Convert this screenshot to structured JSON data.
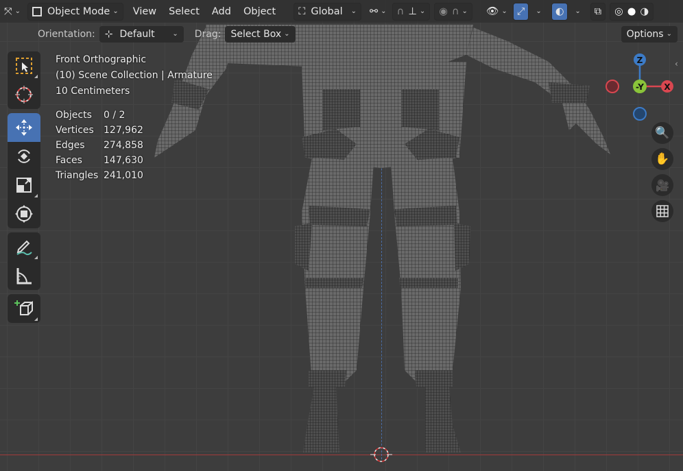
{
  "header": {
    "mode": "Object Mode",
    "menus": [
      "View",
      "Select",
      "Add",
      "Object"
    ],
    "transform_orientation": "Global"
  },
  "tool_settings": {
    "orientation_label": "Orientation:",
    "orientation_value": "Default",
    "drag_label": "Drag:",
    "drag_value": "Select Box",
    "options_label": "Options"
  },
  "viewport": {
    "view_name": "Front Orthographic",
    "collection": "(10) Scene Collection | Armature",
    "scale": "10 Centimeters"
  },
  "stats": [
    {
      "label": "Objects",
      "value": "0 / 2"
    },
    {
      "label": "Vertices",
      "value": "127,962"
    },
    {
      "label": "Edges",
      "value": "274,858"
    },
    {
      "label": "Faces",
      "value": "147,630"
    },
    {
      "label": "Triangles",
      "value": "241,010"
    }
  ],
  "gizmo": {
    "z_label": "Z",
    "y_label": "-Y",
    "x_label": "X",
    "colors": {
      "x": "#d94750",
      "y": "#8ac43a",
      "z": "#3c7bc7"
    }
  },
  "toolbar": {
    "active_tool": "move",
    "accent": "#4772b3"
  }
}
